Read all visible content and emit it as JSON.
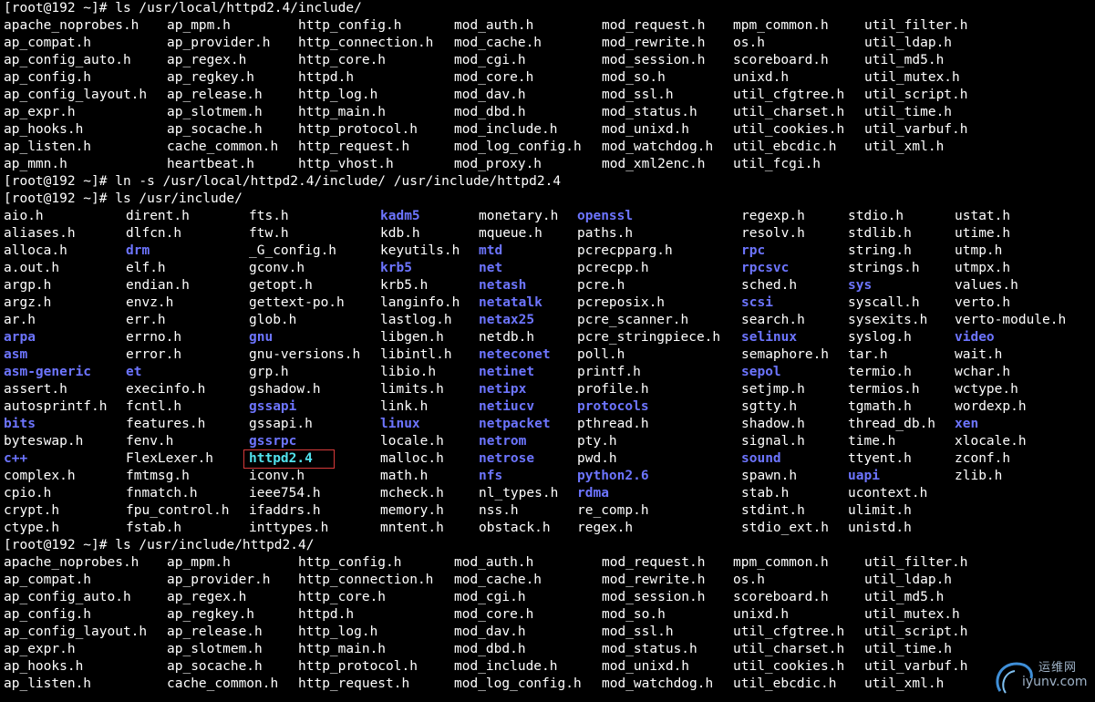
{
  "colors": {
    "background": "#000000",
    "text": "#ffffff",
    "directory": "#6d75ff",
    "symlink": "#52e3ee",
    "highlight_box": "#d83a3a"
  },
  "highlight": {
    "target": "httpd2.4"
  },
  "lines": [
    {
      "type": "prompt",
      "text": "[root@192 ~]# ls /usr/local/httpd2.4/include/"
    },
    {
      "type": "grid",
      "cols": "A",
      "cells": [
        "apache_noprobes.h",
        "ap_mpm.h",
        "http_config.h",
        "mod_auth.h",
        "mod_request.h",
        "mpm_common.h",
        "util_filter.h"
      ]
    },
    {
      "type": "grid",
      "cols": "A",
      "cells": [
        "ap_compat.h",
        "ap_provider.h",
        "http_connection.h",
        "mod_cache.h",
        "mod_rewrite.h",
        "os.h",
        "util_ldap.h"
      ]
    },
    {
      "type": "grid",
      "cols": "A",
      "cells": [
        "ap_config_auto.h",
        "ap_regex.h",
        "http_core.h",
        "mod_cgi.h",
        "mod_session.h",
        "scoreboard.h",
        "util_md5.h"
      ]
    },
    {
      "type": "grid",
      "cols": "A",
      "cells": [
        "ap_config.h",
        "ap_regkey.h",
        "httpd.h",
        "mod_core.h",
        "mod_so.h",
        "unixd.h",
        "util_mutex.h"
      ]
    },
    {
      "type": "grid",
      "cols": "A",
      "cells": [
        "ap_config_layout.h",
        "ap_release.h",
        "http_log.h",
        "mod_dav.h",
        "mod_ssl.h",
        "util_cfgtree.h",
        "util_script.h"
      ]
    },
    {
      "type": "grid",
      "cols": "A",
      "cells": [
        "ap_expr.h",
        "ap_slotmem.h",
        "http_main.h",
        "mod_dbd.h",
        "mod_status.h",
        "util_charset.h",
        "util_time.h"
      ]
    },
    {
      "type": "grid",
      "cols": "A",
      "cells": [
        "ap_hooks.h",
        "ap_socache.h",
        "http_protocol.h",
        "mod_include.h",
        "mod_unixd.h",
        "util_cookies.h",
        "util_varbuf.h"
      ]
    },
    {
      "type": "grid",
      "cols": "A",
      "cells": [
        "ap_listen.h",
        "cache_common.h",
        "http_request.h",
        "mod_log_config.h",
        "mod_watchdog.h",
        "util_ebcdic.h",
        "util_xml.h"
      ]
    },
    {
      "type": "grid",
      "cols": "A",
      "cells": [
        "ap_mmn.h",
        "heartbeat.h",
        "http_vhost.h",
        "mod_proxy.h",
        "mod_xml2enc.h",
        "util_fcgi.h"
      ]
    },
    {
      "type": "prompt",
      "text": "[root@192 ~]# ln -s /usr/local/httpd2.4/include/ /usr/include/httpd2.4"
    },
    {
      "type": "prompt",
      "text": "[root@192 ~]# ls /usr/include/"
    },
    {
      "type": "grid",
      "cols": "B",
      "cells": [
        "aio.h",
        "dirent.h",
        "fts.h",
        "kadm5*",
        "monetary.h",
        "openssl*",
        "regexp.h",
        "stdio.h",
        "ustat.h"
      ]
    },
    {
      "type": "grid",
      "cols": "B",
      "cells": [
        "aliases.h",
        "dlfcn.h",
        "ftw.h",
        "kdb.h",
        "mqueue.h",
        "paths.h",
        "resolv.h",
        "stdlib.h",
        "utime.h"
      ]
    },
    {
      "type": "grid",
      "cols": "B",
      "cells": [
        "alloca.h",
        "drm*",
        "_G_config.h",
        "keyutils.h",
        "mtd*",
        "pcrecpparg.h",
        "rpc*",
        "string.h",
        "utmp.h"
      ]
    },
    {
      "type": "grid",
      "cols": "B",
      "cells": [
        "a.out.h",
        "elf.h",
        "gconv.h",
        "krb5*",
        "net*",
        "pcrecpp.h",
        "rpcsvc*",
        "strings.h",
        "utmpx.h"
      ]
    },
    {
      "type": "grid",
      "cols": "B",
      "cells": [
        "argp.h",
        "endian.h",
        "getopt.h",
        "krb5.h",
        "netash*",
        "pcre.h",
        "sched.h",
        "sys*",
        "values.h"
      ]
    },
    {
      "type": "grid",
      "cols": "B",
      "cells": [
        "argz.h",
        "envz.h",
        "gettext-po.h",
        "langinfo.h",
        "netatalk*",
        "pcreposix.h",
        "scsi*",
        "syscall.h",
        "verto.h"
      ]
    },
    {
      "type": "grid",
      "cols": "B",
      "cells": [
        "ar.h",
        "err.h",
        "glob.h",
        "lastlog.h",
        "netax25*",
        "pcre_scanner.h",
        "search.h",
        "sysexits.h",
        "verto-module.h"
      ]
    },
    {
      "type": "grid",
      "cols": "B",
      "cells": [
        "arpa*",
        "errno.h",
        "gnu*",
        "libgen.h",
        "netdb.h",
        "pcre_stringpiece.h",
        "selinux*",
        "syslog.h",
        "video*"
      ]
    },
    {
      "type": "grid",
      "cols": "B",
      "cells": [
        "asm*",
        "error.h",
        "gnu-versions.h",
        "libintl.h",
        "neteconet*",
        "poll.h",
        "semaphore.h",
        "tar.h",
        "wait.h"
      ]
    },
    {
      "type": "grid",
      "cols": "B",
      "cells": [
        "asm-generic*",
        "et*",
        "grp.h",
        "libio.h",
        "netinet*",
        "printf.h",
        "sepol*",
        "termio.h",
        "wchar.h"
      ]
    },
    {
      "type": "grid",
      "cols": "B",
      "cells": [
        "assert.h",
        "execinfo.h",
        "gshadow.h",
        "limits.h",
        "netipx*",
        "profile.h",
        "setjmp.h",
        "termios.h",
        "wctype.h"
      ]
    },
    {
      "type": "grid",
      "cols": "B",
      "cells": [
        "autosprintf.h",
        "fcntl.h",
        "gssapi*",
        "link.h",
        "netiucv*",
        "protocols*",
        "sgtty.h",
        "tgmath.h",
        "wordexp.h"
      ]
    },
    {
      "type": "grid",
      "cols": "B",
      "cells": [
        "bits*",
        "features.h",
        "gssapi.h",
        "linux*",
        "netpacket*",
        "pthread.h",
        "shadow.h",
        "thread_db.h",
        "xen*"
      ]
    },
    {
      "type": "grid",
      "cols": "B",
      "cells": [
        "byteswap.h",
        "fenv.h",
        "gssrpc*",
        "locale.h",
        "netrom*",
        "pty.h",
        "signal.h",
        "time.h",
        "xlocale.h"
      ]
    },
    {
      "type": "grid",
      "cols": "B",
      "cells": [
        "c++*",
        "FlexLexer.h",
        "httpd2.4@",
        "malloc.h",
        "netrose*",
        "pwd.h",
        "sound*",
        "ttyent.h",
        "zconf.h"
      ]
    },
    {
      "type": "grid",
      "cols": "B",
      "cells": [
        "complex.h",
        "fmtmsg.h",
        "iconv.h",
        "math.h",
        "nfs*",
        "python2.6*",
        "spawn.h",
        "uapi*",
        "zlib.h"
      ]
    },
    {
      "type": "grid",
      "cols": "B",
      "cells": [
        "cpio.h",
        "fnmatch.h",
        "ieee754.h",
        "mcheck.h",
        "nl_types.h",
        "rdma*",
        "stab.h",
        "ucontext.h",
        ""
      ]
    },
    {
      "type": "grid",
      "cols": "B",
      "cells": [
        "crypt.h",
        "fpu_control.h",
        "ifaddrs.h",
        "memory.h",
        "nss.h",
        "re_comp.h",
        "stdint.h",
        "ulimit.h",
        ""
      ]
    },
    {
      "type": "grid",
      "cols": "B",
      "cells": [
        "ctype.h",
        "fstab.h",
        "inttypes.h",
        "mntent.h",
        "obstack.h",
        "regex.h",
        "stdio_ext.h",
        "unistd.h",
        ""
      ]
    },
    {
      "type": "prompt",
      "text": "[root@192 ~]# ls /usr/include/httpd2.4/"
    },
    {
      "type": "grid",
      "cols": "A",
      "cells": [
        "apache_noprobes.h",
        "ap_mpm.h",
        "http_config.h",
        "mod_auth.h",
        "mod_request.h",
        "mpm_common.h",
        "util_filter.h"
      ]
    },
    {
      "type": "grid",
      "cols": "A",
      "cells": [
        "ap_compat.h",
        "ap_provider.h",
        "http_connection.h",
        "mod_cache.h",
        "mod_rewrite.h",
        "os.h",
        "util_ldap.h"
      ]
    },
    {
      "type": "grid",
      "cols": "A",
      "cells": [
        "ap_config_auto.h",
        "ap_regex.h",
        "http_core.h",
        "mod_cgi.h",
        "mod_session.h",
        "scoreboard.h",
        "util_md5.h"
      ]
    },
    {
      "type": "grid",
      "cols": "A",
      "cells": [
        "ap_config.h",
        "ap_regkey.h",
        "httpd.h",
        "mod_core.h",
        "mod_so.h",
        "unixd.h",
        "util_mutex.h"
      ]
    },
    {
      "type": "grid",
      "cols": "A",
      "cells": [
        "ap_config_layout.h",
        "ap_release.h",
        "http_log.h",
        "mod_dav.h",
        "mod_ssl.h",
        "util_cfgtree.h",
        "util_script.h"
      ]
    },
    {
      "type": "grid",
      "cols": "A",
      "cells": [
        "ap_expr.h",
        "ap_slotmem.h",
        "http_main.h",
        "mod_dbd.h",
        "mod_status.h",
        "util_charset.h",
        "util_time.h"
      ]
    },
    {
      "type": "grid",
      "cols": "A",
      "cells": [
        "ap_hooks.h",
        "ap_socache.h",
        "http_protocol.h",
        "mod_include.h",
        "mod_unixd.h",
        "util_cookies.h",
        "util_varbuf.h"
      ]
    },
    {
      "type": "grid",
      "cols": "A",
      "cells": [
        "ap_listen.h",
        "cache_common.h",
        "http_request.h",
        "mod_log_config.h",
        "mod_watchdog.h",
        "util_ebcdic.h",
        "util_xml.h"
      ]
    }
  ],
  "watermark": {
    "line1": "运维网",
    "line2": "iyunv.com"
  }
}
